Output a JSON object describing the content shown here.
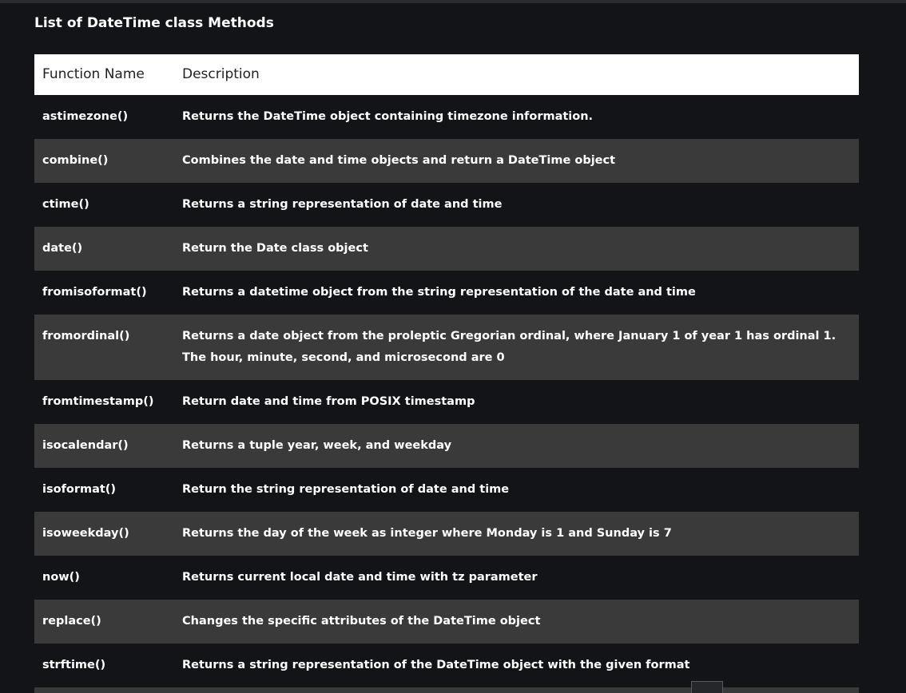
{
  "heading": "List of DateTime class Methods",
  "table": {
    "headers": {
      "function_name": "Function Name",
      "description": "Description"
    },
    "rows": [
      {
        "name": "astimezone()",
        "description": "Returns the DateTime object containing timezone information."
      },
      {
        "name": "combine()",
        "description": "Combines the date and time objects and return a DateTime object"
      },
      {
        "name": "ctime()",
        "description": "Returns a string representation of date and time"
      },
      {
        "name": "date()",
        "description": "Return the Date class object"
      },
      {
        "name": "fromisoformat()",
        "description": "Returns a datetime object from the string representation of the date and time"
      },
      {
        "name": "fromordinal()",
        "description": "Returns a date object from the proleptic Gregorian ordinal, where January 1 of year 1 has ordinal 1. The hour, minute, second, and microsecond are 0"
      },
      {
        "name": "fromtimestamp()",
        "description": "Return date and time from POSIX timestamp"
      },
      {
        "name": "isocalendar()",
        "description": "Returns a tuple year, week, and weekday"
      },
      {
        "name": "isoformat()",
        "description": "Return the string representation of date and time"
      },
      {
        "name": "isoweekday()",
        "description": "Returns the day of the week as integer where Monday is 1 and Sunday is 7"
      },
      {
        "name": "now()",
        "description": "Returns current local date and time with tz parameter"
      },
      {
        "name": "replace()",
        "description": "Changes the specific attributes of the DateTime object"
      },
      {
        "name": "strftime()",
        "description": "Returns a string representation of the DateTime object with the given format"
      },
      {
        "name": "",
        "description": ""
      }
    ]
  },
  "colors": {
    "page_background": "#131417",
    "row_alt_background": "#3a3a3a",
    "header_background": "#ffffff",
    "header_text": "#1f2023",
    "text": "#ffffff"
  }
}
